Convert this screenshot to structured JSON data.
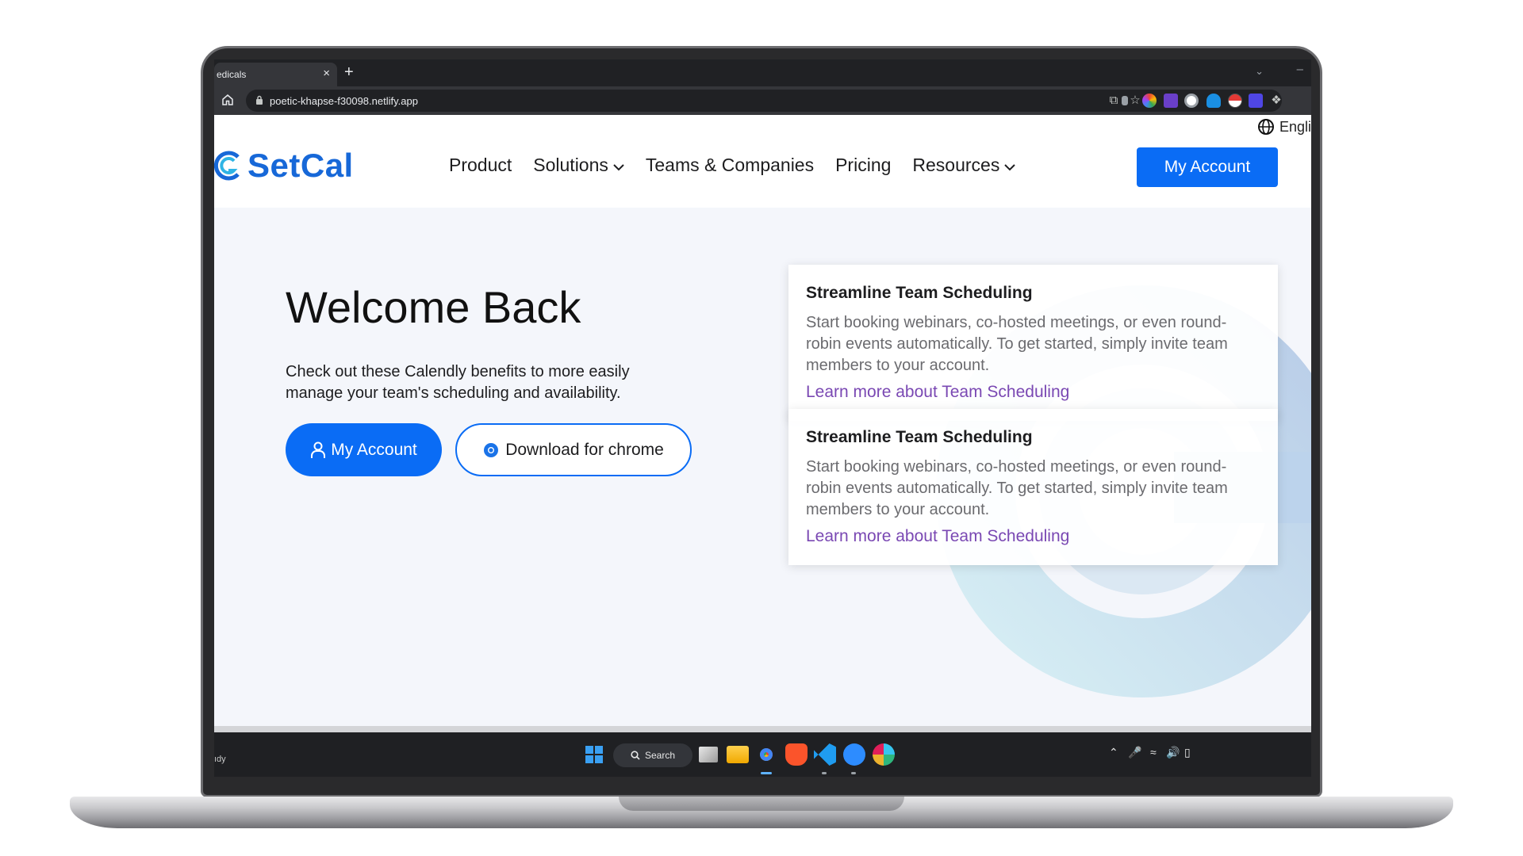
{
  "browser": {
    "tab_title": "edicals",
    "tab_close": "×",
    "new_tab": "+",
    "url": "poetic-khapse-f30098.netlify.app"
  },
  "site": {
    "language": "Engli",
    "logo_text": "SetCal",
    "nav": [
      "Product",
      "Solutions",
      "Teams & Companies",
      "Pricing",
      "Resources"
    ],
    "account_button": "My Account"
  },
  "hero": {
    "title": "Welcome Back",
    "subtitle": "Check out these Calendly benefits to more easily manage your team's scheduling and availability.",
    "primary_button": "My Account",
    "secondary_button": "Download for chrome"
  },
  "cards": [
    {
      "title": "Streamline Team Scheduling",
      "body": "Start booking webinars, co-hosted meetings, or even round-robin events automatically. To get started, simply invite team members to your account.",
      "link": "Learn more about Team Scheduling"
    },
    {
      "title": "Streamline Team Scheduling",
      "body": "Start booking webinars, co-hosted meetings, or even round-robin events automatically. To get started, simply invite team members to your account.",
      "link": "Learn more about Team Scheduling"
    }
  ],
  "taskbar": {
    "left_text": "ıdy",
    "search_label": "Search"
  },
  "colors": {
    "brand_blue": "#0a6cf5",
    "logo_blue": "#1768d8",
    "link_purple": "#7a48b3",
    "page_bg": "#f4f6fb"
  }
}
